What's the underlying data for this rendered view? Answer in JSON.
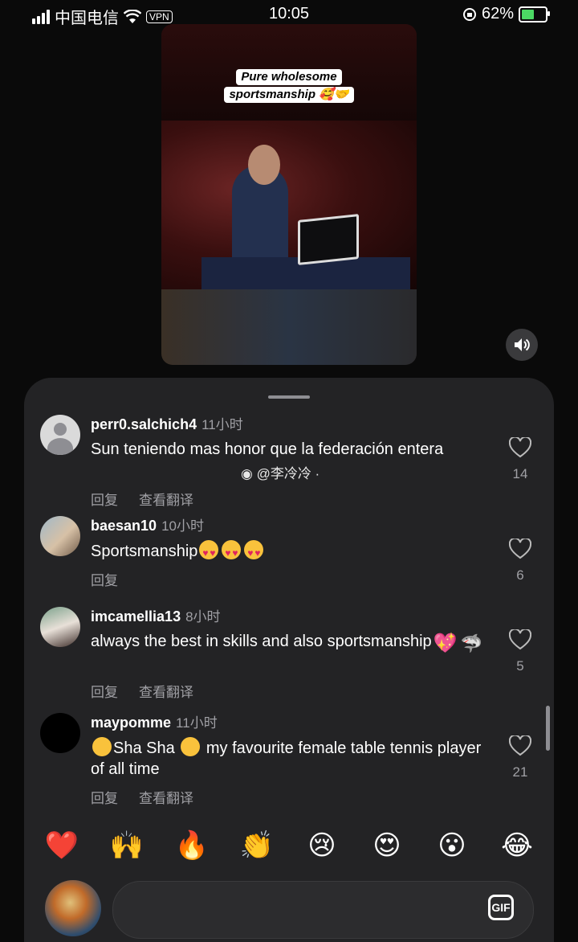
{
  "status_bar": {
    "carrier": "中国电信",
    "vpn": "VPN",
    "time": "10:05",
    "battery": "62%",
    "battery_level": 0.62
  },
  "video": {
    "caption_line1": "Pure wholesome",
    "caption_line2": "sportsmanship 🥰🤝"
  },
  "comments": [
    {
      "username": "perr0.salchich4",
      "time": "11小时",
      "text": "Sun teniendo mas honor que la federación entera",
      "reply": "回复",
      "translate": "查看翻译",
      "likes": "14",
      "avatar": "default-avatar"
    },
    {
      "username": "baesan10",
      "time": "10小时",
      "text": "Sportsmanship",
      "reply": "回复",
      "likes": "6",
      "avatar": "photo"
    },
    {
      "username": "imcamellia13",
      "time": "8小时",
      "text": "always the best in skills and also sportsmanship",
      "reply": "回复",
      "translate": "查看翻译",
      "likes": "5",
      "avatar": "photo"
    },
    {
      "username": "maypomme",
      "time": "11小时",
      "text_a": "Sha Sha",
      "text_b": "my favourite female table tennis player of all time",
      "reply": "回复",
      "translate": "查看翻译",
      "likes": "21",
      "avatar": "black"
    }
  ],
  "watermark": "@李冷冷",
  "reactions": [
    "❤️",
    "🙌",
    "🔥",
    "👏",
    "😢",
    "😍",
    "😮",
    "😂"
  ],
  "composer": {
    "gif_label": "GIF"
  },
  "colors": {
    "sheet_bg": "#232325",
    "secondary_text": "#a0a0a5"
  }
}
